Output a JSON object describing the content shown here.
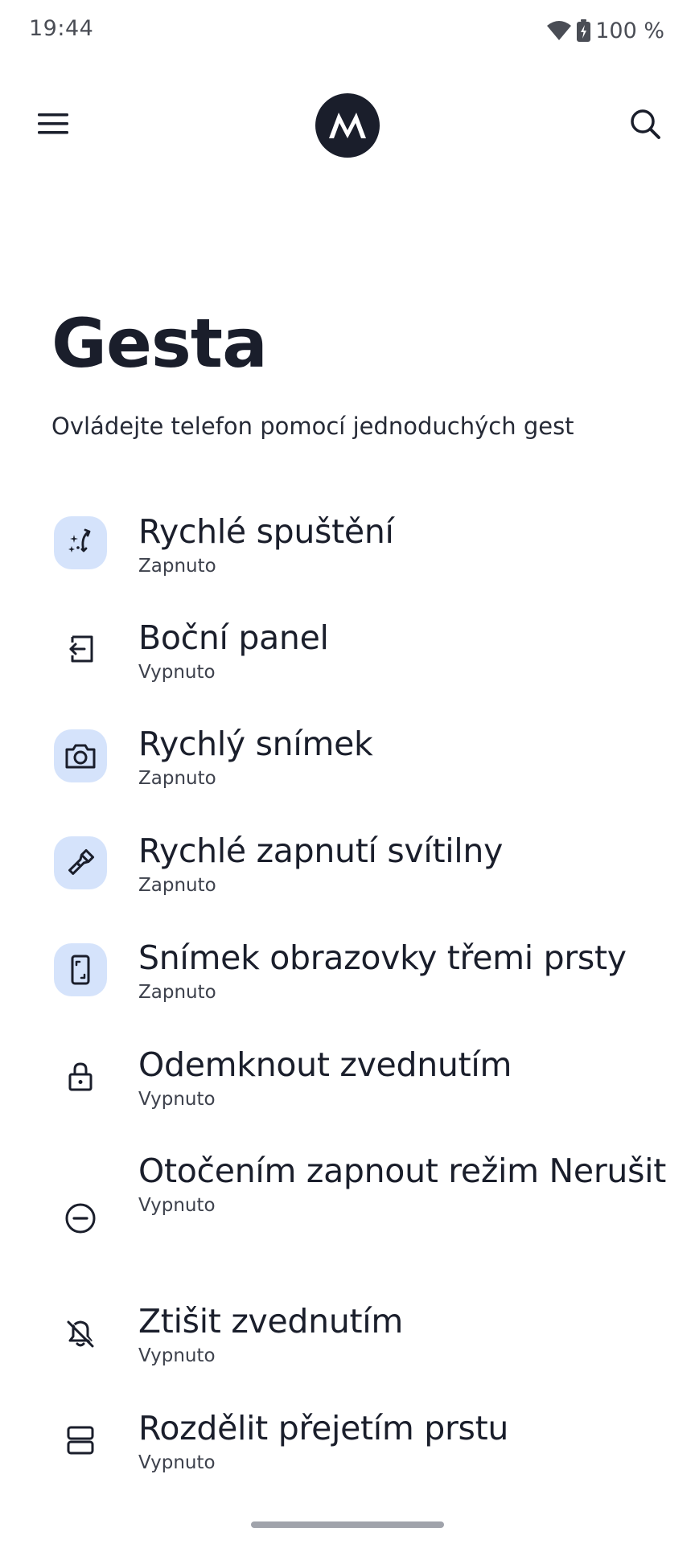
{
  "status_bar": {
    "time": "19:44",
    "battery": "100 %",
    "icons": [
      "wifi-icon",
      "battery-charging-icon"
    ]
  },
  "app_bar": {
    "menu_icon": "hamburger-menu-icon",
    "logo": "motorola-logo",
    "search_icon": "search-icon"
  },
  "header": {
    "title": "Gesta",
    "subtitle": "Ovládejte telefon pomocí jednoduchých gest"
  },
  "items": [
    {
      "title": "Rychlé spuštění",
      "status": "Zapnuto",
      "icon": "quick-launch-twist-icon",
      "highlight": true
    },
    {
      "title": "Boční panel",
      "status": "Vypnuto",
      "icon": "side-panel-icon",
      "highlight": false
    },
    {
      "title": "Rychlý snímek",
      "status": "Zapnuto",
      "icon": "camera-icon",
      "highlight": true
    },
    {
      "title": "Rychlé zapnutí svítilny",
      "status": "Zapnuto",
      "icon": "flashlight-icon",
      "highlight": true
    },
    {
      "title": "Snímek obrazovky třemi prsty",
      "status": "Zapnuto",
      "icon": "screenshot-phone-icon",
      "highlight": true
    },
    {
      "title": "Odemknout zvednutím",
      "status": "Vypnuto",
      "icon": "lock-icon",
      "highlight": false
    },
    {
      "title": "Otočením zapnout režim Nerušit",
      "status": "Vypnuto",
      "icon": "do-not-disturb-icon",
      "highlight": false
    },
    {
      "title": "Ztišit zvednutím",
      "status": "Vypnuto",
      "icon": "bell-off-icon",
      "highlight": false
    },
    {
      "title": "Rozdělit přejetím prstu",
      "status": "Vypnuto",
      "icon": "split-screen-icon",
      "highlight": false
    }
  ],
  "colors": {
    "text_primary": "#1a1e2b",
    "icon_highlight_bg": "#d5e3fb",
    "logo_bg": "#1a1e2b"
  }
}
